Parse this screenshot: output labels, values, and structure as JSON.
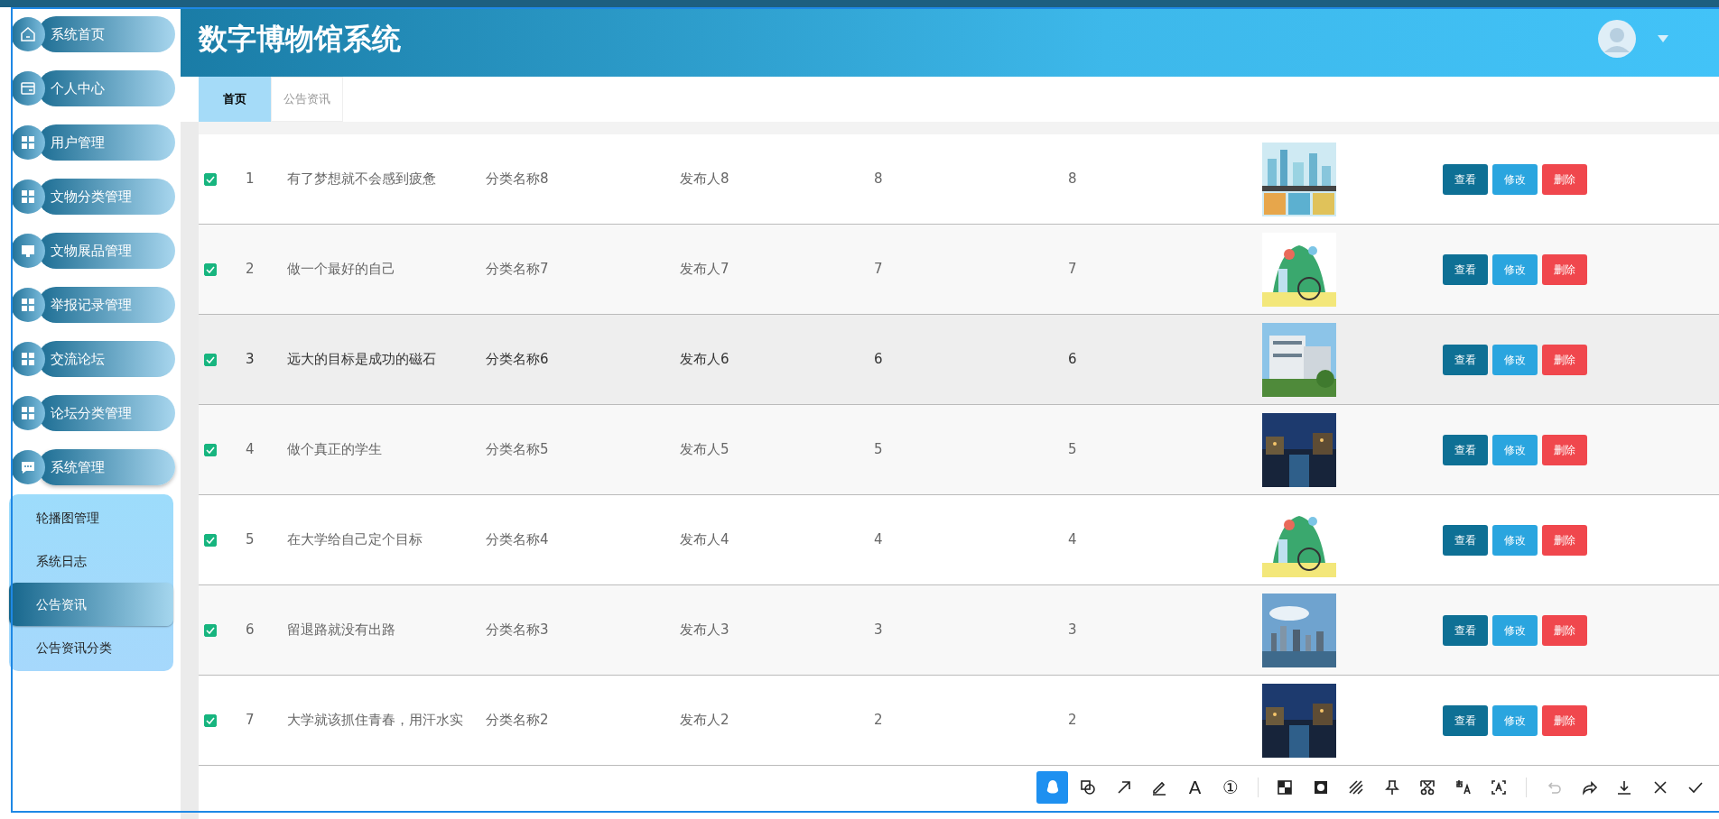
{
  "header": {
    "title": "数字博物馆系统"
  },
  "sidebar": {
    "items": [
      {
        "label": "系统首页",
        "expanded": false
      },
      {
        "label": "个人中心",
        "expanded": false
      },
      {
        "label": "用户管理",
        "expanded": false
      },
      {
        "label": "文物分类管理",
        "expanded": false
      },
      {
        "label": "文物展品管理",
        "expanded": false
      },
      {
        "label": "举报记录管理",
        "expanded": false
      },
      {
        "label": "交流论坛",
        "expanded": false
      },
      {
        "label": "论坛分类管理",
        "expanded": false
      },
      {
        "label": "系统管理",
        "expanded": true,
        "children": [
          {
            "label": "轮播图管理",
            "selected": false
          },
          {
            "label": "系统日志",
            "selected": false
          },
          {
            "label": "公告资讯",
            "selected": true
          },
          {
            "label": "公告资讯分类",
            "selected": false
          }
        ]
      }
    ]
  },
  "tabs": [
    {
      "label": "首页",
      "selected": true
    },
    {
      "label": "公告资讯",
      "selected": false
    }
  ],
  "table": {
    "rows": [
      {
        "checked": true,
        "hovered": false,
        "index": "1",
        "title": "有了梦想就不会感到疲惫",
        "category": "分类名称8",
        "publisher": "发布人8",
        "clicks": "8",
        "favorites": "8",
        "picture": {
          "kind": "picture"
        },
        "actions": [
          "查看",
          "修改",
          "删除"
        ]
      },
      {
        "checked": true,
        "hovered": false,
        "index": "2",
        "title": "做一个最好的自己",
        "category": "分类名称7",
        "publisher": "发布人7",
        "clicks": "7",
        "favorites": "7",
        "picture": {
          "kind": "picture"
        },
        "actions": [
          "查看",
          "修改",
          "删除"
        ]
      },
      {
        "checked": true,
        "hovered": true,
        "index": "3",
        "title": "远大的目标是成功的磁石",
        "category": "分类名称6",
        "publisher": "发布人6",
        "clicks": "6",
        "favorites": "6",
        "picture": {
          "kind": "picture"
        },
        "actions": [
          "查看",
          "修改",
          "删除"
        ]
      },
      {
        "checked": true,
        "hovered": false,
        "index": "4",
        "title": "做个真正的学生",
        "category": "分类名称5",
        "publisher": "发布人5",
        "clicks": "5",
        "favorites": "5",
        "picture": {
          "kind": "picture"
        },
        "actions": [
          "查看",
          "修改",
          "删除"
        ]
      },
      {
        "checked": true,
        "hovered": false,
        "index": "5",
        "title": "在大学给自己定个目标",
        "category": "分类名称4",
        "publisher": "发布人4",
        "clicks": "4",
        "favorites": "4",
        "picture": {
          "kind": "picture"
        },
        "actions": [
          "查看",
          "修改",
          "删除"
        ]
      },
      {
        "checked": true,
        "hovered": false,
        "index": "6",
        "title": "留退路就没有出路",
        "category": "分类名称3",
        "publisher": "发布人3",
        "clicks": "3",
        "favorites": "3",
        "picture": {
          "kind": "picture"
        },
        "actions": [
          "查看",
          "修改",
          "删除"
        ]
      },
      {
        "checked": true,
        "hovered": false,
        "index": "7",
        "title": "大学就该抓住青春，用汗水实",
        "category": "分类名称2",
        "publisher": "发布人2",
        "clicks": "2",
        "favorites": "2",
        "picture": {
          "kind": "picture"
        },
        "actions": [
          "查看",
          "修改",
          "删除"
        ]
      }
    ]
  },
  "capture_toolbar": {
    "groups": [
      [
        {
          "kind": "icon",
          "selected": true,
          "disabled": false
        },
        {
          "kind": "icon",
          "selected": false,
          "disabled": false
        },
        {
          "kind": "icon",
          "selected": false,
          "disabled": false
        },
        {
          "kind": "icon",
          "selected": false,
          "disabled": false
        },
        {
          "kind": "glyph",
          "label": "A",
          "selected": false,
          "disabled": false
        },
        {
          "kind": "glyph",
          "label": "①",
          "selected": false,
          "disabled": false
        }
      ],
      [
        {
          "kind": "icon",
          "selected": false,
          "disabled": false
        },
        {
          "kind": "icon",
          "selected": false,
          "disabled": false
        },
        {
          "kind": "icon",
          "selected": false,
          "disabled": false
        },
        {
          "kind": "icon",
          "selected": false,
          "disabled": false
        },
        {
          "kind": "icon",
          "selected": false,
          "disabled": false
        },
        {
          "kind": "icon",
          "selected": false,
          "disabled": false
        },
        {
          "kind": "icon",
          "selected": false,
          "disabled": false
        }
      ],
      [
        {
          "kind": "icon",
          "disabled": true
        },
        {
          "kind": "icon",
          "disabled": false
        },
        {
          "kind": "icon",
          "disabled": false
        },
        {
          "kind": "icon",
          "disabled": false
        },
        {
          "kind": "icon",
          "disabled": false
        }
      ]
    ]
  }
}
